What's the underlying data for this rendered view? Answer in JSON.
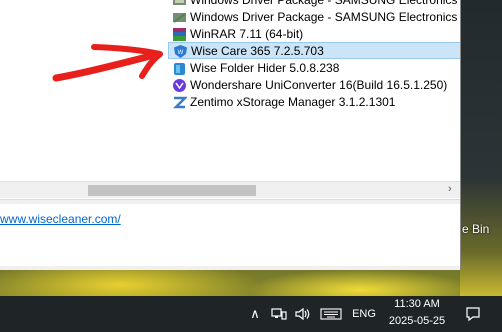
{
  "programs": [
    {
      "name": "Windows Driver Package - SAMSUNG Electronics Co",
      "icon": "driver-package-icon"
    },
    {
      "name": "Windows Driver Package - SAMSUNG Electronics Co",
      "icon": "driver-package-icon"
    },
    {
      "name": "WinRAR 7.11 (64-bit)",
      "icon": "winrar-icon"
    },
    {
      "name": "Wise Care 365 7.2.5.703",
      "icon": "wise-care-icon",
      "selected": true
    },
    {
      "name": "Wise Folder Hider 5.0.8.238",
      "icon": "wise-folder-hider-icon"
    },
    {
      "name": "Wondershare UniConverter 16(Build 16.5.1.250)",
      "icon": "uniconverter-icon"
    },
    {
      "name": "Zentimo xStorage Manager 3.1.2.1301",
      "icon": "zentimo-icon"
    }
  ],
  "details": {
    "link": "www.wisecleaner.com/"
  },
  "desktop": {
    "recycle_bin_label": "e Bin"
  },
  "taskbar": {
    "language": "ENG",
    "time": "11:30 AM",
    "date": "2025-05-25"
  },
  "colors": {
    "selection": "#cce4f7",
    "annotation": "#e8201c",
    "taskbar": "#1f2526",
    "link": "#0066cc"
  }
}
